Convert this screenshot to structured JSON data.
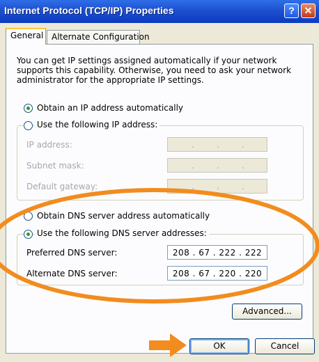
{
  "window": {
    "title": "Internet Protocol (TCP/IP) Properties",
    "help_label": "?",
    "close_label": "✕"
  },
  "tabs": [
    {
      "label": "General"
    },
    {
      "label": "Alternate Configuration"
    }
  ],
  "info_text": "You can get IP settings assigned automatically if your network supports this capability. Otherwise, you need to ask your network administrator for the appropriate IP settings.",
  "ip_section": {
    "auto_label": "Obtain an IP address automatically",
    "manual_label": "Use the following IP address:",
    "selected": "auto",
    "fields": [
      {
        "label": "IP address:"
      },
      {
        "label": "Subnet mask:"
      },
      {
        "label": "Default gateway:"
      }
    ]
  },
  "dns_section": {
    "auto_label": "Obtain DNS server address automatically",
    "manual_label": "Use the following DNS server addresses:",
    "selected": "manual",
    "preferred": {
      "label": "Preferred DNS server:",
      "value": "208 . 67 . 222 . 222"
    },
    "alternate": {
      "label": "Alternate DNS server:",
      "value": "208 . 67 . 220 . 220"
    }
  },
  "buttons": {
    "advanced": "Advanced...",
    "ok": "OK",
    "cancel": "Cancel"
  },
  "annotation": {
    "color": "#f28c1e",
    "shapes": [
      "ellipse-highlight",
      "arrow-pointing-right"
    ]
  }
}
